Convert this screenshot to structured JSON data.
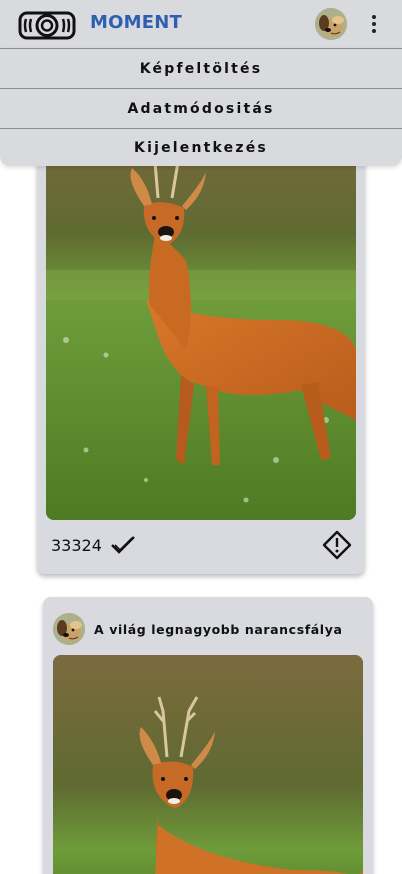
{
  "header": {
    "brand": "MOMENT",
    "logo_icon": "camera-icon",
    "avatar_icon": "dog-avatar-icon",
    "menu_icon": "kebab-menu-icon"
  },
  "menu": {
    "items": [
      {
        "label": "Képfeltöltés"
      },
      {
        "label": "Adatmódositás"
      },
      {
        "label": "Kijelentkezés"
      }
    ]
  },
  "posts": [
    {
      "image": "roe-deer-photo",
      "likes": "33324",
      "like_icon": "checkmark-icon",
      "report_icon": "warning-diamond-icon"
    },
    {
      "title": "A világ legnagyobb narancsfálya",
      "avatar_icon": "dog-avatar-icon",
      "image": "roe-deer-photo"
    }
  ],
  "colors": {
    "header_bg": "#d9dadd",
    "brand": "#2f5fb0",
    "card_bg": "#d8dadf"
  }
}
